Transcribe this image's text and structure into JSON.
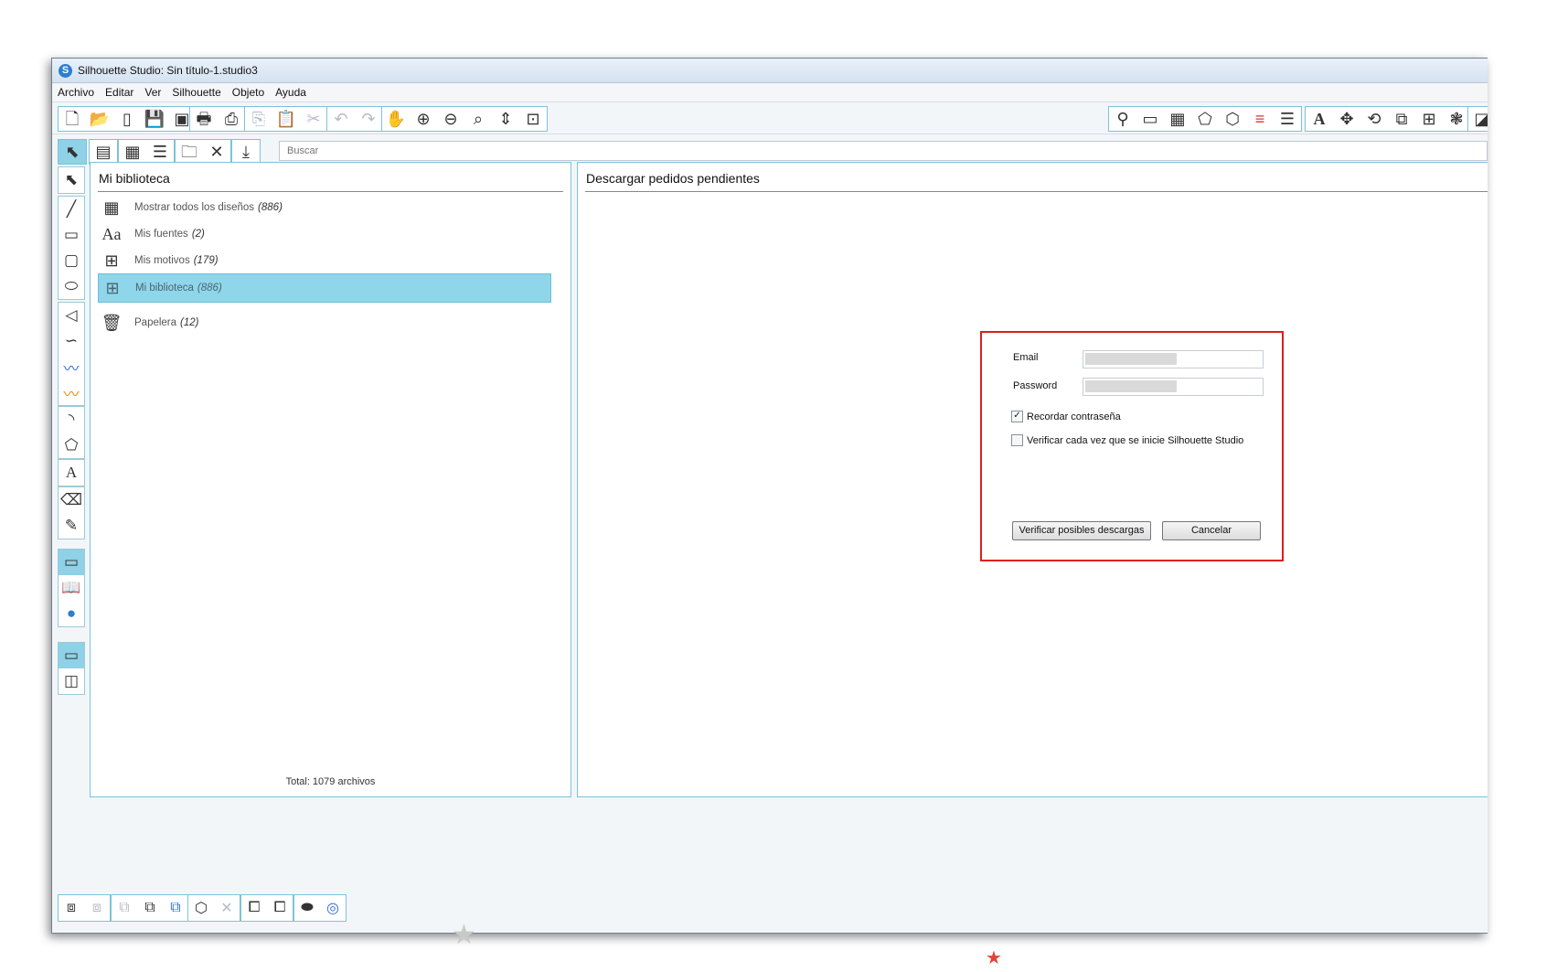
{
  "window": {
    "title": "Silhouette Studio: Sin título-1.studio3",
    "logo_letter": "S"
  },
  "menu": [
    "Archivo",
    "Editar",
    "Ver",
    "Silhouette",
    "Objeto",
    "Ayuda"
  ],
  "search": {
    "placeholder": "Buscar"
  },
  "library": {
    "title": "Mi biblioteca",
    "items": [
      {
        "label": "Mostrar todos los diseños",
        "count": "(886)",
        "icon": "grid-icon"
      },
      {
        "label": "Mis fuentes",
        "count": "(2)",
        "icon": "font-icon"
      },
      {
        "label": "Mis motivos",
        "count": "(179)",
        "icon": "folder-plus-icon"
      },
      {
        "label": "Mi biblioteca",
        "count": "(886)",
        "icon": "folder-plus-icon"
      },
      {
        "label": "Papelera",
        "count": "(12)",
        "icon": "trash-icon"
      }
    ],
    "total": "Total: 1079 archivos"
  },
  "downloads": {
    "title": "Descargar pedidos pendientes",
    "email_label": "Email",
    "password_label": "Password",
    "remember_label": "Recordar contraseña",
    "remember_checked": true,
    "verify_startup_label": "Verificar cada vez que se inicie Silhouette Studio",
    "verify_startup_checked": false,
    "verify_button": "Verificar posibles descargas",
    "cancel_button": "Cancelar"
  },
  "icons": {
    "library_item_glyphs": [
      "▦",
      "Aa",
      "⊞",
      "⊞",
      "🗑"
    ],
    "checkbox_checked": "✓"
  },
  "colors": {
    "accent": "#7cc3d8",
    "selection": "#8fd6ea",
    "dialog_border": "#e11d1d"
  }
}
